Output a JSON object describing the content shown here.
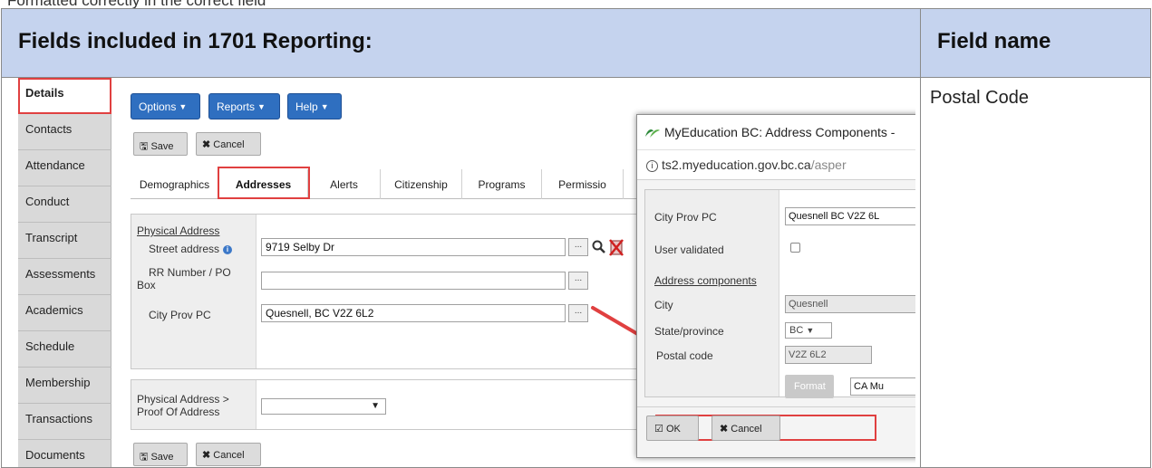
{
  "caption": "Formatted correctly in the correct field",
  "doc": {
    "header_title": "Fields included in 1701 Reporting:",
    "header_field": "Field name",
    "field_value": "Postal Code"
  },
  "nav": {
    "items": [
      "Details",
      "Contacts",
      "Attendance",
      "Conduct",
      "Transcript",
      "Assessments",
      "Academics",
      "Schedule",
      "Membership",
      "Transactions",
      "Documents"
    ]
  },
  "toolbar": {
    "options": "Options",
    "reports": "Reports",
    "help": "Help",
    "save": "Save",
    "cancel": "Cancel"
  },
  "tabs": [
    "Demographics",
    "Addresses",
    "Alerts",
    "Citizenship",
    "Programs",
    "Permissio"
  ],
  "form": {
    "section_title": "Physical Address",
    "street_label": "Street address",
    "street_value": "9719 Selby Dr",
    "rr_label_1": "RR Number / PO",
    "rr_label_2": "Box",
    "rr_value": "",
    "city_label": "City Prov PC",
    "city_value": "Quesnell, BC V2Z 6L2",
    "proof_label_1": "Physical Address >",
    "proof_label_2": "Proof Of Address",
    "dots": "..."
  },
  "popup": {
    "title": "MyEducation BC: Address Components -",
    "url_host": "ts2.myeducation.gov.bc.ca",
    "url_path": "/asper",
    "city_prov_label": "City Prov PC",
    "city_prov_value": "Quesnell BC  V2Z 6L",
    "validated_label": "User validated",
    "components_label": "Address components",
    "city_label": "City",
    "city_value": "Quesnell",
    "state_label": "State/province",
    "state_value": "BC",
    "postal_label": "Postal code",
    "postal_value": "V2Z 6L2",
    "format_label": "Format",
    "format_value": "CA Mu",
    "ok_label": "OK",
    "cancel_label": "Cancel"
  },
  "colors": {
    "highlight": "#e04040",
    "button_blue": "#2f6fc0",
    "header_bg": "#c5d3ee"
  }
}
